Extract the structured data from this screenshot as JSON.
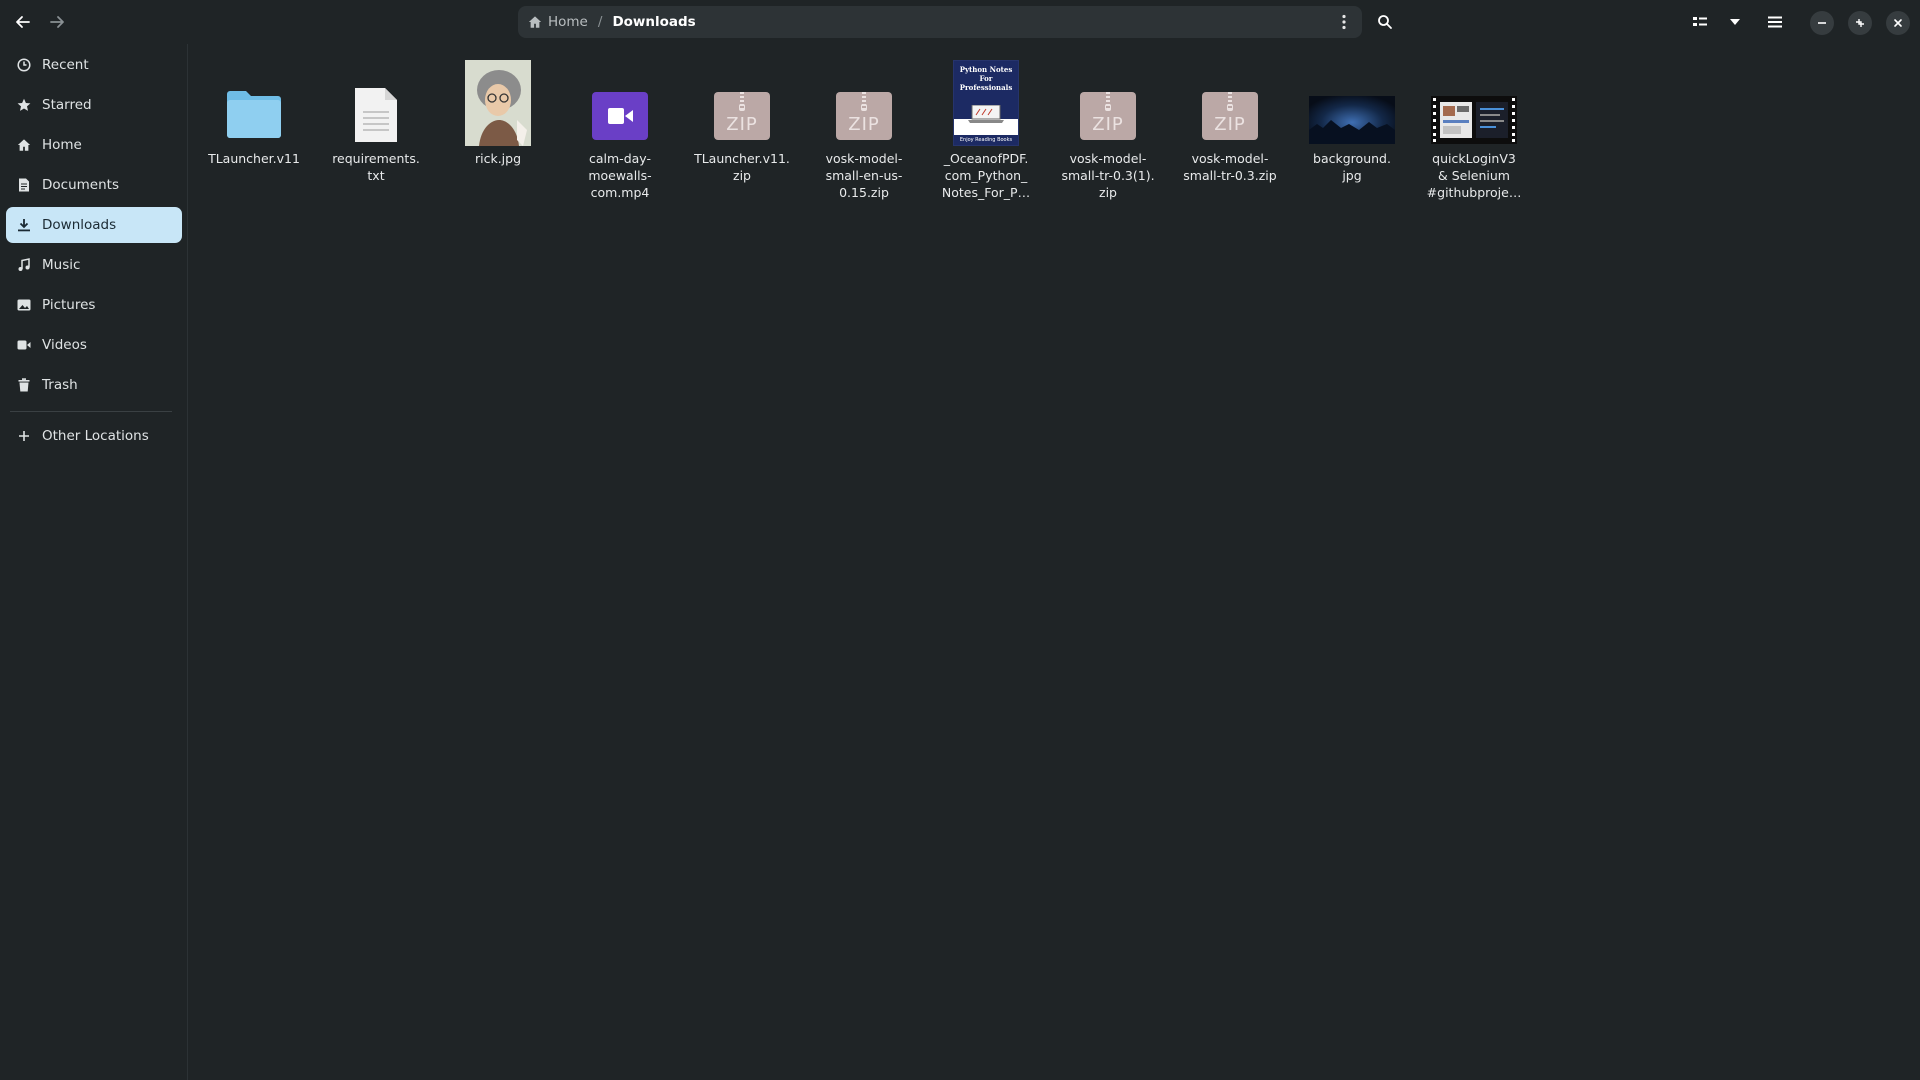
{
  "headerbar": {
    "back_icon": "arrow-left-icon",
    "forward_icon": "arrow-right-icon",
    "path": [
      {
        "label": "Home",
        "icon": "home-icon"
      },
      {
        "label": "Downloads"
      }
    ],
    "separator": "/",
    "search_icon": "search-icon",
    "view_icon": "list-view-icon",
    "view_menu_icon": "chevron-down-icon",
    "main_menu_icon": "hamburger-menu-icon"
  },
  "sidebar": {
    "items": [
      {
        "label": "Recent",
        "icon": "clock-icon"
      },
      {
        "label": "Starred",
        "icon": "star-icon"
      },
      {
        "label": "Home",
        "icon": "home-icon"
      },
      {
        "label": "Documents",
        "icon": "document-icon"
      },
      {
        "label": "Downloads",
        "icon": "download-icon",
        "active": true
      },
      {
        "label": "Music",
        "icon": "music-icon"
      },
      {
        "label": "Pictures",
        "icon": "picture-icon"
      },
      {
        "label": "Videos",
        "icon": "video-icon"
      },
      {
        "label": "Trash",
        "icon": "trash-icon"
      }
    ],
    "other_locations": {
      "label": "Other Locations",
      "icon": "plus-icon"
    }
  },
  "files": [
    {
      "name": "TLauncher.v11",
      "type": "folder"
    },
    {
      "name": "requirements.\ntxt",
      "type": "text"
    },
    {
      "name": "rick.jpg",
      "type": "image-portrait"
    },
    {
      "name": "calm-day-\nmoewalls-\ncom.mp4",
      "type": "video"
    },
    {
      "name": "TLauncher.v11.\nzip",
      "type": "zip"
    },
    {
      "name": "vosk-model-\nsmall-en-us-\n0.15.zip",
      "type": "zip"
    },
    {
      "name": "_OceanofPDF.\ncom_Python_\nNotes_For_P…",
      "type": "pdf",
      "cover_title": "Python Notes For Professionals",
      "cover_footer": "Enjoy Reading Books"
    },
    {
      "name": "vosk-model-\nsmall-tr-0.3(1).\nzip",
      "type": "zip"
    },
    {
      "name": "vosk-model-\nsmall-tr-0.3.zip",
      "type": "zip"
    },
    {
      "name": "background.\njpg",
      "type": "image-landscape"
    },
    {
      "name": "quickLoginV3\n& Selenium\n#githubproje…",
      "type": "video-thumb"
    }
  ],
  "zip_label": "ZIP",
  "colors": {
    "background": "#1f2426",
    "sidebar_active": "#c8e6f7",
    "folder": "#8fcff0",
    "video_icon": "#6a3fc6",
    "zip_icon": "#bba8a6"
  }
}
